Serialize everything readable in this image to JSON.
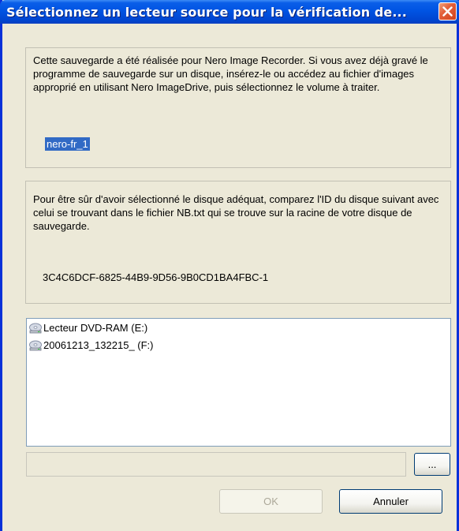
{
  "window": {
    "title": "Sélectionnez un lecteur source pour la vérification de...",
    "close_icon": "close-icon"
  },
  "info_group": {
    "text": "Cette sauvegarde a été réalisée pour Nero Image Recorder. Si vous avez déjà gravé le programme de sauvegarde sur un disque, insérez-le ou accédez au fichier d'images approprié en utilisant Nero ImageDrive, puis sélectionnez le volume à traiter.",
    "volume_name": "nero-fr_1"
  },
  "id_group": {
    "text": "Pour être sûr d'avoir sélectionné le disque adéquat, comparez l'ID du disque suivant avec celui se trouvant dans le fichier NB.txt qui se trouve sur la racine de votre disque de sauvegarde.",
    "disc_id": "3C4C6DCF-6825-44B9-9D56-9B0CD1BA4FBC-1"
  },
  "drives": [
    {
      "label": "Lecteur DVD-RAM (E:)",
      "icon": "optical-drive-icon"
    },
    {
      "label": "20061213_132215_ (F:)",
      "icon": "optical-drive-icon"
    }
  ],
  "path_field": {
    "value": ""
  },
  "buttons": {
    "browse": "...",
    "ok": "OK",
    "cancel": "Annuler"
  }
}
